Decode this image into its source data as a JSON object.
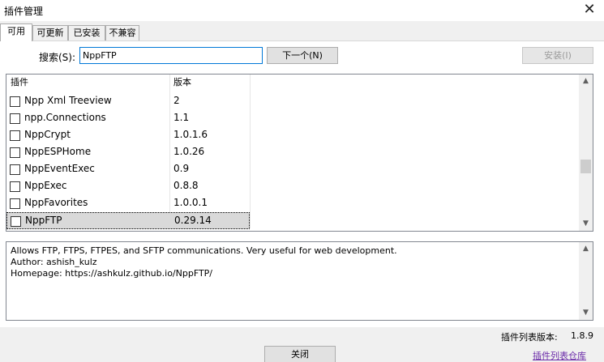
{
  "window": {
    "title": "插件管理",
    "close_glyph": "✕"
  },
  "tabs": [
    {
      "label": "可用",
      "active": true
    },
    {
      "label": "可更新",
      "active": false
    },
    {
      "label": "已安装",
      "active": false
    },
    {
      "label": "不兼容",
      "active": false
    }
  ],
  "search": {
    "label": "搜索(S):",
    "value": "NppFTP",
    "next_button": "下一个(N)",
    "install_button": "安装(I)"
  },
  "list": {
    "columns": [
      "插件",
      "版本"
    ],
    "rows": [
      {
        "name": "Npp Xml Treeview",
        "version": "2",
        "checked": false,
        "selected": false
      },
      {
        "name": "npp.Connections",
        "version": "1.1",
        "checked": false,
        "selected": false
      },
      {
        "name": "NppCrypt",
        "version": "1.0.1.6",
        "checked": false,
        "selected": false
      },
      {
        "name": "NppESPHome",
        "version": "1.0.26",
        "checked": false,
        "selected": false
      },
      {
        "name": "NppEventExec",
        "version": "0.9",
        "checked": false,
        "selected": false
      },
      {
        "name": "NppExec",
        "version": "0.8.8",
        "checked": false,
        "selected": false
      },
      {
        "name": "NppFavorites",
        "version": "1.0.0.1",
        "checked": false,
        "selected": false
      },
      {
        "name": "NppFTP",
        "version": "0.29.14",
        "checked": false,
        "selected": true
      }
    ],
    "scroll_position": 0.62
  },
  "description": {
    "lines": [
      "Allows FTP, FTPS, FTPES, and SFTP communications. Very useful for web development.",
      "Author: ashish_kulz",
      "Homepage: https://ashkulz.github.io/NppFTP/"
    ]
  },
  "footer": {
    "list_version_label": "插件列表版本:",
    "list_version_value": "1.8.9",
    "close_button": "关闭",
    "repo_link": "插件列表仓库"
  },
  "icons": {
    "scroll_up": "▲",
    "scroll_down": "▼"
  },
  "colors": {
    "accent": "#0078d7",
    "link": "#6a2aa8",
    "selection": "#d9d9d9"
  }
}
